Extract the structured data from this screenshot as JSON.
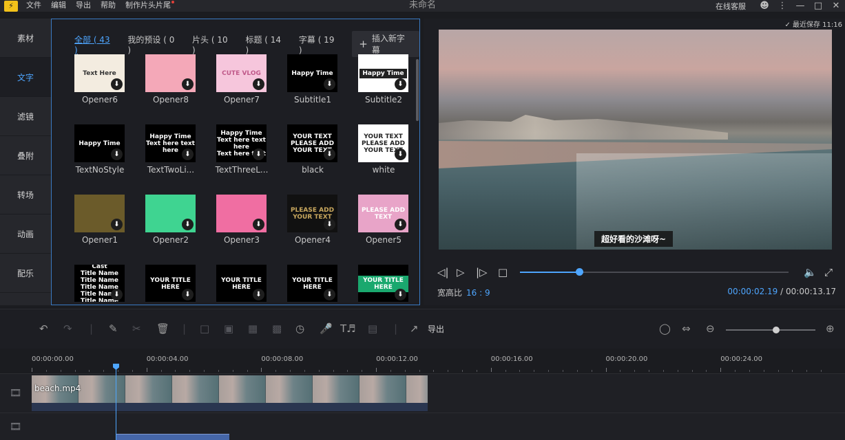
{
  "titlebar": {
    "logo": "⚡",
    "menu": [
      "文件",
      "编辑",
      "导出",
      "帮助",
      "制作片头片尾"
    ],
    "title": "未命名",
    "online_service": "在线客服"
  },
  "leftnav": [
    "素材",
    "文字",
    "滤镜",
    "叠附",
    "转场",
    "动画",
    "配乐"
  ],
  "library": {
    "tabs": [
      "全部 ( 43 )",
      "我的预设 ( 0 )",
      "片头 ( 10 )",
      "标题 ( 14 )",
      "字幕 ( 19 )"
    ],
    "insert_button": "插入新字幕",
    "cards": [
      {
        "label": "Opener6",
        "thumb_text": "Text Here"
      },
      {
        "label": "Opener8",
        "thumb_text": ""
      },
      {
        "label": "Opener7",
        "thumb_text": "CUTE VLOG"
      },
      {
        "label": "Subtitle1",
        "thumb_text": "Happy Time"
      },
      {
        "label": "Subtitle2",
        "thumb_text": "Happy Time"
      },
      {
        "label": "TextNoStyle",
        "thumb_text": "Happy Time"
      },
      {
        "label": "TextTwoLi...",
        "thumb_text": "Happy Time\nText here text here"
      },
      {
        "label": "TextThreeL...",
        "thumb_text": "Happy Time\nText here text here\nText here text"
      },
      {
        "label": "black",
        "thumb_text": "YOUR TEXT\nPLEASE ADD YOUR TEXT"
      },
      {
        "label": "white",
        "thumb_text": "YOUR TEXT\nPLEASE ADD YOUR TEXT"
      },
      {
        "label": "Opener1",
        "thumb_text": ""
      },
      {
        "label": "Opener2",
        "thumb_text": ""
      },
      {
        "label": "Opener3",
        "thumb_text": ""
      },
      {
        "label": "Opener4",
        "thumb_text": "PLEASE ADD YOUR TEXT"
      },
      {
        "label": "Opener5",
        "thumb_text": "PLEASE ADD TEXT"
      },
      {
        "label": "",
        "thumb_text": "Cast\nTitle Name\nTitle Name\nTitle Name\nTitle Name\nTitle Name"
      },
      {
        "label": "",
        "thumb_text": "YOUR TITLE HERE"
      },
      {
        "label": "",
        "thumb_text": "YOUR TITLE HERE"
      },
      {
        "label": "",
        "thumb_text": "YOUR TITLE HERE"
      },
      {
        "label": "",
        "thumb_text": "YOUR TITLE HERE"
      }
    ]
  },
  "preview": {
    "saved": "最近保存 11:16",
    "subtitle": "超好看的沙滩呀~",
    "aspect_label": "宽高比",
    "aspect_value": "16 : 9",
    "current_time": "00:00:02.19",
    "separator": "/",
    "total_time": "00:00:13.17",
    "progress": 0.22
  },
  "toolbar": {
    "export_label": "导出",
    "zoom_level": 0.56
  },
  "timeline": {
    "ticks": [
      "00:00:00.00",
      "00:00:04.00",
      "00:00:08.00",
      "00:00:12.00",
      "00:00:16.00",
      "00:00:20.00",
      "00:00:24.00"
    ],
    "clip_name": "beach.mp4"
  },
  "colors": {
    "accent": "#4ea6ff",
    "border": "#3a7bc4",
    "bg": "#1b1c20"
  }
}
